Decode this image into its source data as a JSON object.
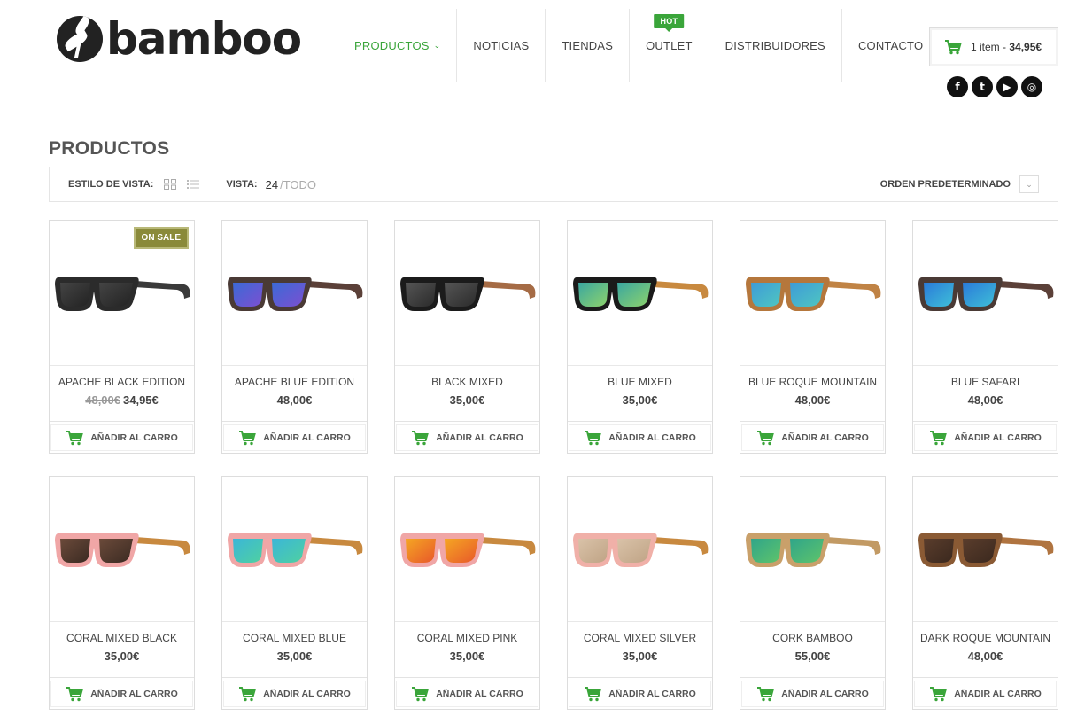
{
  "brand": {
    "name": "bamboo"
  },
  "nav": [
    {
      "label": "PRODUCTOS",
      "active": true,
      "has_caret": true,
      "badge": ""
    },
    {
      "label": "NOTICIAS",
      "active": false,
      "has_caret": false,
      "badge": ""
    },
    {
      "label": "TIENDAS",
      "active": false,
      "has_caret": false,
      "badge": ""
    },
    {
      "label": "OUTLET",
      "active": false,
      "has_caret": false,
      "badge": "HOT"
    },
    {
      "label": "DISTRIBUIDORES",
      "active": false,
      "has_caret": false,
      "badge": ""
    },
    {
      "label": "CONTACTO",
      "active": false,
      "has_caret": false,
      "badge": ""
    }
  ],
  "cart": {
    "items": "1 item",
    "separator": " - ",
    "total": "34,95€",
    "icon": "cart-icon"
  },
  "socials": [
    {
      "name": "facebook-icon",
      "glyph": "f"
    },
    {
      "name": "twitter-icon",
      "glyph": "t"
    },
    {
      "name": "youtube-icon",
      "glyph": "▶"
    },
    {
      "name": "instagram-icon",
      "glyph": "◎"
    }
  ],
  "page_title": "PRODUCTOS",
  "toolbar": {
    "view_style_label": "ESTILO DE VISTA:",
    "vista_label": "VISTA:",
    "vista_current": "24",
    "vista_sep": "/",
    "vista_all": "TODO",
    "order_label": "ORDEN PREDETERMINADO"
  },
  "add_to_cart_label": "AÑADIR AL CARRO",
  "colors": {
    "accent": "#3aa53a",
    "sale_badge": "#8a8a3a"
  },
  "products": [
    {
      "name": "APACHE BLACK EDITION",
      "old_price": "48,00€",
      "price": "34,95€",
      "badge": "ON SALE",
      "frame": "#2b2b2b",
      "temple": "#3a3a3a",
      "lens": "#444",
      "lens2": "#222"
    },
    {
      "name": "APACHE BLUE EDITION",
      "old_price": "",
      "price": "48,00€",
      "badge": "",
      "frame": "#4a3a35",
      "temple": "#5b4038",
      "lens": "#3b6ad6",
      "lens2": "#7d4fd1"
    },
    {
      "name": "BLACK MIXED",
      "old_price": "",
      "price": "35,00€",
      "badge": "",
      "frame": "#1b1b1b",
      "temple": "#a56b45",
      "lens": "#555",
      "lens2": "#2a2a2a"
    },
    {
      "name": "BLUE MIXED",
      "old_price": "",
      "price": "35,00€",
      "badge": "",
      "frame": "#1a1a1a",
      "temple": "#c8893f",
      "lens": "#3aa6a0",
      "lens2": "#8fd46b"
    },
    {
      "name": "BLUE ROQUE MOUNTAIN",
      "old_price": "",
      "price": "48,00€",
      "badge": "",
      "frame": "#b5773c",
      "temple": "#c08345",
      "lens": "#3e9bd8",
      "lens2": "#4fc7c0"
    },
    {
      "name": "BLUE SAFARI",
      "old_price": "",
      "price": "48,00€",
      "badge": "",
      "frame": "#4a3a35",
      "temple": "#5b4038",
      "lens": "#2a7ad9",
      "lens2": "#3fc0d8"
    },
    {
      "name": "CORAL MIXED BLACK",
      "old_price": "",
      "price": "35,00€",
      "badge": "",
      "frame": "#f0a6a6",
      "temple": "#c8893f",
      "lens": "#6b4a3a",
      "lens2": "#3a2a22"
    },
    {
      "name": "CORAL MIXED BLUE",
      "old_price": "",
      "price": "35,00€",
      "badge": "",
      "frame": "#f0a6a6",
      "temple": "#c8893f",
      "lens": "#3bb6d8",
      "lens2": "#4fd1a0"
    },
    {
      "name": "CORAL MIXED PINK",
      "old_price": "",
      "price": "35,00€",
      "badge": "",
      "frame": "#f0a6a6",
      "temple": "#c8893f",
      "lens": "#f5a623",
      "lens2": "#e8572a"
    },
    {
      "name": "CORAL MIXED SILVER",
      "old_price": "",
      "price": "35,00€",
      "badge": "",
      "frame": "#f0b0a8",
      "temple": "#c8893f",
      "lens": "#d9c2a8",
      "lens2": "#bfa385"
    },
    {
      "name": "CORK BAMBOO",
      "old_price": "",
      "price": "55,00€",
      "badge": "",
      "frame": "#c9a06a",
      "temple": "#c29a64",
      "lens": "#2fa58a",
      "lens2": "#5fc46a"
    },
    {
      "name": "DARK ROQUE MOUNTAIN",
      "old_price": "",
      "price": "48,00€",
      "badge": "",
      "frame": "#8a5a34",
      "temple": "#b07440",
      "lens": "#5a3d2c",
      "lens2": "#3a281e"
    }
  ]
}
